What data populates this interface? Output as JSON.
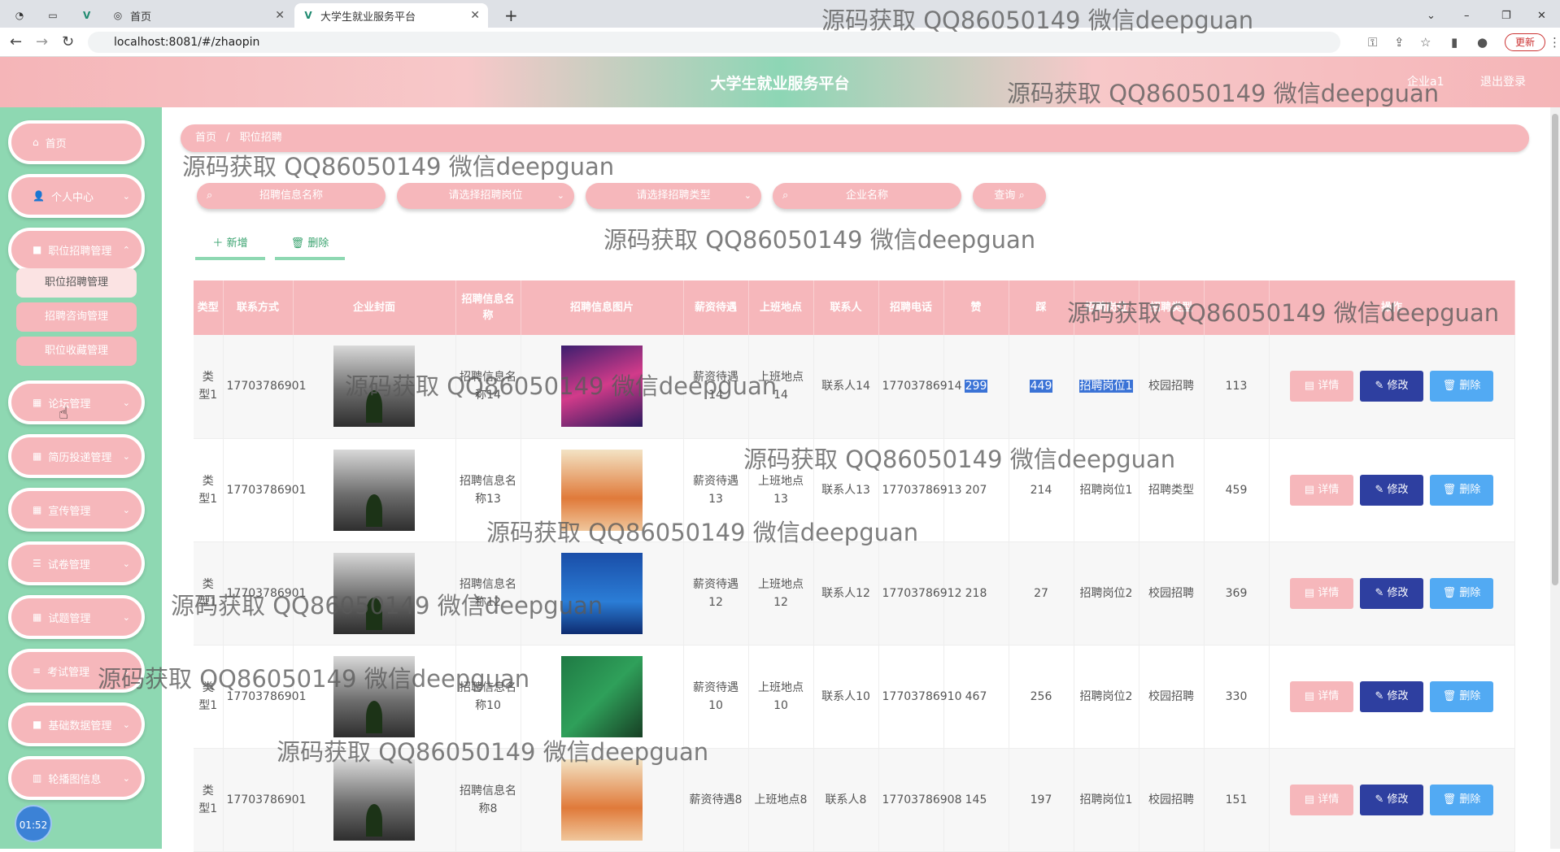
{
  "browser": {
    "tabs": [
      {
        "label": ""
      },
      {
        "label": "首页"
      },
      {
        "label": "大学生就业服务平台"
      }
    ],
    "url": "localhost:8081/#/zhaopin",
    "update_label": "更新"
  },
  "header": {
    "title": "大学生就业服务平台",
    "user": "企业a1",
    "logout": "退出登录"
  },
  "sidebar": {
    "items": [
      {
        "label": "首页",
        "icon": "home-icon"
      },
      {
        "label": "个人中心",
        "icon": "user-icon"
      },
      {
        "label": "职位招聘管理",
        "icon": "briefcase-icon"
      },
      {
        "label": "论坛管理",
        "icon": "grid-icon"
      },
      {
        "label": "简历投递管理",
        "icon": "grid-icon"
      },
      {
        "label": "宣传管理",
        "icon": "grid-icon"
      },
      {
        "label": "试卷管理",
        "icon": "sliders-icon"
      },
      {
        "label": "试题管理",
        "icon": "grid-icon"
      },
      {
        "label": "考试管理",
        "icon": "list-icon"
      },
      {
        "label": "基础数据管理",
        "icon": "briefcase-icon"
      },
      {
        "label": "轮播图信息",
        "icon": "chart-icon"
      }
    ],
    "submenu": [
      {
        "label": "职位招聘管理"
      },
      {
        "label": "招聘咨询管理"
      },
      {
        "label": "职位收藏管理"
      }
    ],
    "clock": "01:52"
  },
  "breadcrumb": {
    "home": "首页",
    "separator": "/",
    "current": "职位招聘"
  },
  "filters": {
    "name_placeholder": "招聘信息名称",
    "position_placeholder": "请选择招聘岗位",
    "type_placeholder": "请选择招聘类型",
    "company_placeholder": "企业名称",
    "query_label": "查询"
  },
  "actions": {
    "add_label": "新增",
    "delete_label": "删除"
  },
  "table": {
    "headers": [
      "类型",
      "联系方式",
      "企业封面",
      "招聘信息名称",
      "招聘信息图片",
      "薪资待遇",
      "上班地点",
      "联系人",
      "招聘电话",
      "赞",
      "踩",
      "招聘岗位",
      "招聘类型",
      "",
      "操作"
    ],
    "rows": [
      {
        "type": "类型1",
        "contact": "17703786901",
        "name": "招聘信息名称14",
        "salary": "薪资待遇14",
        "location": "上班地点14",
        "person": "联系人14",
        "phone": "17703786914",
        "likes": "299",
        "dislikes": "449",
        "position": "招聘岗位1",
        "jobtype": "校园招聘",
        "count": "113"
      },
      {
        "type": "类型1",
        "contact": "17703786901",
        "name": "招聘信息名称13",
        "salary": "薪资待遇13",
        "location": "上班地点13",
        "person": "联系人13",
        "phone": "17703786913",
        "likes": "207",
        "dislikes": "214",
        "position": "招聘岗位1",
        "jobtype": "招聘类型",
        "count": "459"
      },
      {
        "type": "类型1",
        "contact": "17703786901",
        "name": "招聘信息名称12",
        "salary": "薪资待遇12",
        "location": "上班地点12",
        "person": "联系人12",
        "phone": "17703786912",
        "likes": "218",
        "dislikes": "27",
        "position": "招聘岗位2",
        "jobtype": "校园招聘",
        "count": "369"
      },
      {
        "type": "类型1",
        "contact": "17703786901",
        "name": "招聘信息名称10",
        "salary": "薪资待遇10",
        "location": "上班地点10",
        "person": "联系人10",
        "phone": "17703786910",
        "likes": "467",
        "dislikes": "256",
        "position": "招聘岗位2",
        "jobtype": "校园招聘",
        "count": "330"
      },
      {
        "type": "类型1",
        "contact": "17703786901",
        "name": "招聘信息名称8",
        "salary": "薪资待遇8",
        "location": "上班地点8",
        "person": "联系人8",
        "phone": "17703786908",
        "likes": "145",
        "dislikes": "197",
        "position": "招聘岗位1",
        "jobtype": "校园招聘",
        "count": "151"
      }
    ],
    "btn_detail": "详情",
    "btn_edit": "修改",
    "btn_delete": "删除"
  },
  "watermark": "源码获取 QQ86050149 微信deepguan",
  "colors": {
    "pink": "#f6b7bb",
    "green": "#8ed8b2",
    "edit": "#2e3fa0",
    "delete": "#52aaf3"
  }
}
